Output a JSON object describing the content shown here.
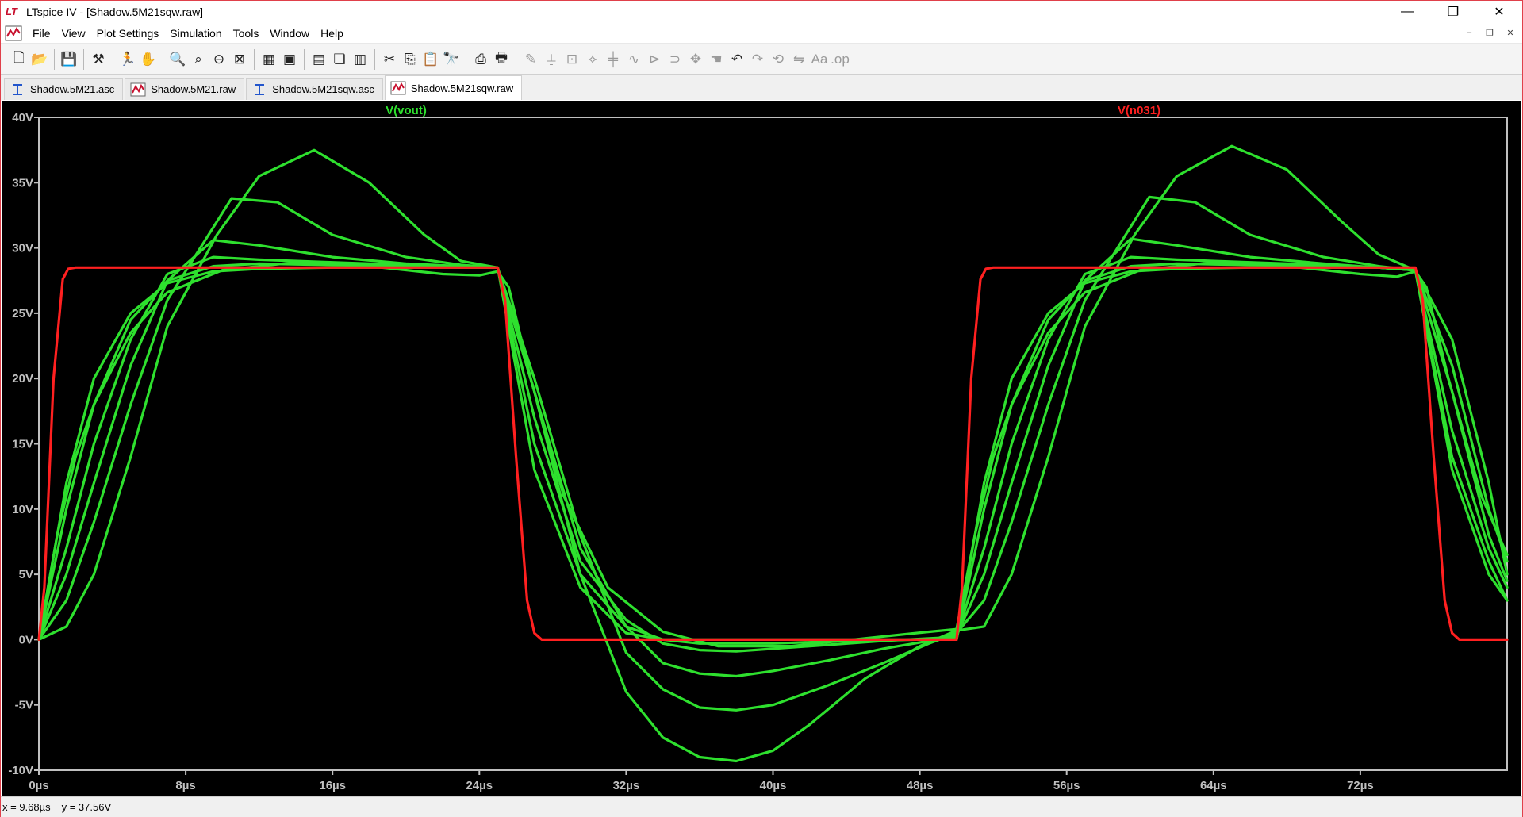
{
  "window": {
    "title": "LTspice IV - [Shadow.5M21sqw.raw]",
    "logo_text": "LT",
    "minimize": "—",
    "restore": "❐",
    "close": "✕"
  },
  "menu": {
    "items": [
      {
        "label": "File"
      },
      {
        "label": "View"
      },
      {
        "label": "Plot Settings"
      },
      {
        "label": "Simulation"
      },
      {
        "label": "Tools"
      },
      {
        "label": "Window"
      },
      {
        "label": "Help"
      }
    ],
    "mdi_minimize": "–",
    "mdi_restore": "❐",
    "mdi_close": "✕"
  },
  "toolbar": {
    "buttons": [
      {
        "icon": "new-schematic-icon",
        "glyph": "🗋",
        "enabled": true
      },
      {
        "icon": "open-icon",
        "glyph": "📂",
        "enabled": true
      },
      {
        "sep": true
      },
      {
        "icon": "save-icon",
        "glyph": "💾",
        "enabled": true
      },
      {
        "sep": true
      },
      {
        "icon": "control-panel-icon",
        "glyph": "⚒",
        "enabled": true
      },
      {
        "sep": true
      },
      {
        "icon": "run-icon",
        "glyph": "🏃",
        "enabled": true
      },
      {
        "icon": "halt-icon",
        "glyph": "✋",
        "enabled": false
      },
      {
        "sep": true
      },
      {
        "icon": "zoom-in-icon",
        "glyph": "🔍",
        "enabled": true
      },
      {
        "icon": "zoom-pan-icon",
        "glyph": "⌕",
        "enabled": true
      },
      {
        "icon": "zoom-out-icon",
        "glyph": "⊖",
        "enabled": true
      },
      {
        "icon": "zoom-fit-icon",
        "glyph": "⊠",
        "enabled": true
      },
      {
        "sep": true
      },
      {
        "icon": "autorange-icon",
        "glyph": "▦",
        "enabled": true
      },
      {
        "icon": "plot-settings-icon",
        "glyph": "▣",
        "enabled": true
      },
      {
        "sep": true
      },
      {
        "icon": "tile-horizontal-icon",
        "glyph": "▤",
        "enabled": true
      },
      {
        "icon": "cascade-icon",
        "glyph": "❏",
        "enabled": true
      },
      {
        "icon": "tile-vertical-icon",
        "glyph": "▥",
        "enabled": true
      },
      {
        "sep": true
      },
      {
        "icon": "cut-icon",
        "glyph": "✂",
        "enabled": true
      },
      {
        "icon": "copy-icon",
        "glyph": "⎘",
        "enabled": true
      },
      {
        "icon": "paste-icon",
        "glyph": "📋",
        "enabled": true
      },
      {
        "icon": "find-icon",
        "glyph": "🔭",
        "enabled": true
      },
      {
        "sep": true
      },
      {
        "icon": "print-preview-icon",
        "glyph": "⎙",
        "enabled": true
      },
      {
        "icon": "print-icon",
        "glyph": "🖶",
        "enabled": true
      },
      {
        "sep": true
      },
      {
        "icon": "wire-icon",
        "glyph": "✎",
        "enabled": false
      },
      {
        "icon": "ground-icon",
        "glyph": "⏚",
        "enabled": false
      },
      {
        "icon": "label-net-icon",
        "glyph": "⊡",
        "enabled": false
      },
      {
        "icon": "resistor-icon",
        "glyph": "⟡",
        "enabled": false
      },
      {
        "icon": "capacitor-icon",
        "glyph": "╪",
        "enabled": false
      },
      {
        "icon": "inductor-icon",
        "glyph": "∿",
        "enabled": false
      },
      {
        "icon": "diode-icon",
        "glyph": "⊳",
        "enabled": false
      },
      {
        "icon": "component-icon",
        "glyph": "⊃",
        "enabled": false
      },
      {
        "icon": "move-icon",
        "glyph": "✥",
        "enabled": false
      },
      {
        "icon": "drag-icon",
        "glyph": "☚",
        "enabled": false
      },
      {
        "icon": "undo-icon",
        "glyph": "↶",
        "enabled": true
      },
      {
        "icon": "redo-icon",
        "glyph": "↷",
        "enabled": false
      },
      {
        "icon": "rotate-icon",
        "glyph": "⟲",
        "enabled": false
      },
      {
        "icon": "mirror-icon",
        "glyph": "⇋",
        "enabled": false
      },
      {
        "icon": "text-icon",
        "glyph": "Aa",
        "enabled": false
      },
      {
        "icon": "spice-directive-icon",
        "glyph": ".op",
        "enabled": false
      }
    ]
  },
  "tabs": [
    {
      "label": "Shadow.5M21.asc",
      "icon": "schematic-icon",
      "active": false
    },
    {
      "label": "Shadow.5M21.raw",
      "icon": "waveform-icon",
      "active": false
    },
    {
      "label": "Shadow.5M21sqw.asc",
      "icon": "schematic-icon",
      "active": false
    },
    {
      "label": "Shadow.5M21sqw.raw",
      "icon": "waveform-icon",
      "active": true
    }
  ],
  "status": {
    "x": "x = 9.68µs",
    "y": "y = 37.56V"
  },
  "chart_data": {
    "type": "line",
    "xlabel": "",
    "ylabel": "",
    "xlim": [
      0,
      80
    ],
    "ylim": [
      -10,
      40
    ],
    "x_ticks": [
      0,
      8,
      16,
      24,
      32,
      40,
      48,
      56,
      64,
      72
    ],
    "x_tick_labels": [
      "0µs",
      "8µs",
      "16µs",
      "24µs",
      "32µs",
      "40µs",
      "48µs",
      "56µs",
      "64µs",
      "72µs"
    ],
    "y_ticks": [
      40,
      35,
      30,
      25,
      20,
      15,
      10,
      5,
      0,
      -5,
      -10
    ],
    "y_tick_labels": [
      "40V",
      "35V",
      "30V",
      "25V",
      "20V",
      "15V",
      "10V",
      "5V",
      "0V",
      "-5V",
      "-10V"
    ],
    "background": "#000000",
    "axis_color": "#c0c0c0",
    "series": [
      {
        "name": "V(n031)",
        "color": "#ff2020",
        "x": [
          0,
          0.3,
          0.8,
          1.3,
          1.6,
          2,
          25,
          25.4,
          26,
          26.6,
          27,
          27.4,
          50,
          50.3,
          50.8,
          51.3,
          51.6,
          52,
          75,
          75.4,
          76,
          76.6,
          77,
          77.4,
          80
        ],
        "y": [
          0,
          4,
          20,
          27.6,
          28.4,
          28.5,
          28.5,
          26,
          14,
          3,
          0.5,
          0,
          0,
          4,
          20,
          27.6,
          28.4,
          28.5,
          28.5,
          26,
          14,
          3,
          0.5,
          0,
          0
        ]
      },
      {
        "name": "V(vout)",
        "color": "#2ee02e",
        "x": [
          0,
          1.5,
          3,
          5,
          7,
          9.7,
          12,
          15,
          18,
          21,
          23,
          25,
          27,
          29.5,
          32,
          34,
          36,
          38,
          40,
          42,
          45,
          48,
          50,
          51.5,
          53,
          55,
          57,
          59.7,
          62,
          65,
          68,
          71,
          73,
          75,
          77,
          79,
          80
        ],
        "y": [
          0,
          1,
          5,
          14,
          24,
          31,
          35.5,
          37.5,
          35,
          31,
          29,
          28.5,
          19,
          5,
          -4,
          -7.5,
          -9,
          -9.3,
          -8.5,
          -6.5,
          -3,
          -0.5,
          0.7,
          1,
          5,
          14,
          24,
          31,
          35.5,
          37.8,
          36,
          32,
          29.5,
          28.3,
          23,
          12,
          5
        ]
      },
      {
        "name": "",
        "color": "#2ee02e",
        "x": [
          0,
          1.5,
          3,
          5,
          7,
          10.5,
          13,
          16,
          20,
          23,
          25,
          27,
          29.5,
          32,
          34,
          36,
          38,
          40,
          43,
          46,
          48.5,
          50,
          51.5,
          53,
          55,
          57,
          60.5,
          63,
          66,
          70,
          73,
          75,
          77,
          79,
          80
        ],
        "y": [
          0,
          3,
          9,
          18,
          26,
          33.8,
          33.5,
          31,
          29.3,
          28.7,
          28.5,
          20,
          8,
          -1,
          -3.8,
          -5.2,
          -5.4,
          -5,
          -3.5,
          -1.8,
          -0.3,
          0.5,
          3,
          9,
          18,
          26,
          33.9,
          33.5,
          31,
          29.3,
          28.6,
          28.3,
          21,
          10,
          6
        ]
      },
      {
        "name": "",
        "color": "#2ee02e",
        "x": [
          0,
          1.5,
          3,
          5,
          7,
          9.5,
          12,
          16,
          20,
          23,
          25,
          27,
          29.5,
          32,
          34,
          36,
          38,
          40,
          43,
          46,
          48.5,
          50,
          51.5,
          53,
          55,
          57,
          59.5,
          62,
          66,
          70,
          73,
          75,
          77,
          79,
          80
        ],
        "y": [
          0,
          5,
          12,
          21,
          27.5,
          30.6,
          30.2,
          29.3,
          28.8,
          28.6,
          28.5,
          19,
          7,
          1,
          -1.8,
          -2.6,
          -2.8,
          -2.4,
          -1.6,
          -0.7,
          -0.1,
          0.3,
          5,
          12,
          21,
          27.5,
          30.7,
          30.2,
          29.3,
          28.8,
          28.5,
          28.3,
          19,
          8,
          4.5
        ]
      },
      {
        "name": "",
        "color": "#2ee02e",
        "x": [
          0,
          1.5,
          3,
          5,
          7,
          9.5,
          12,
          16,
          20,
          23,
          25,
          27,
          29.5,
          32,
          34,
          36,
          38,
          40,
          43,
          46,
          48.5,
          50,
          51.5,
          53,
          55,
          57,
          59.5,
          62,
          66,
          70,
          73,
          75,
          77,
          79,
          80
        ],
        "y": [
          0,
          7,
          15,
          23,
          28,
          29.3,
          29.1,
          28.9,
          28.7,
          28.6,
          28.5,
          17,
          6,
          1.5,
          -0.3,
          -0.8,
          -0.9,
          -0.7,
          -0.4,
          -0.1,
          0.1,
          0.2,
          7,
          15,
          23,
          28,
          29.3,
          29.1,
          28.9,
          28.7,
          28.5,
          28.3,
          16,
          7,
          4
        ]
      },
      {
        "name": "",
        "color": "#2ee02e",
        "x": [
          0,
          1.5,
          3,
          5,
          7,
          9.5,
          12,
          16,
          20,
          23,
          25,
          27,
          29.5,
          32,
          34,
          36,
          40,
          44,
          48,
          50,
          51.5,
          53,
          55,
          57,
          59.5,
          62,
          66,
          70,
          73,
          75,
          77,
          79,
          80
        ],
        "y": [
          0,
          10,
          18,
          24.5,
          27.5,
          28.6,
          28.8,
          28.7,
          28.6,
          28.5,
          28.5,
          15,
          5,
          1,
          0,
          -0.3,
          -0.3,
          -0.1,
          0,
          0,
          10,
          18,
          24.5,
          27.5,
          28.6,
          28.8,
          28.7,
          28.6,
          28.5,
          28.3,
          14,
          6,
          3
        ]
      },
      {
        "name": "",
        "color": "#2ee02e",
        "x": [
          0,
          1.5,
          3,
          5,
          7,
          9.5,
          12,
          16,
          20,
          23,
          25,
          27,
          29.5,
          32,
          34,
          36,
          40,
          44,
          48,
          50,
          51.5,
          53,
          55,
          57,
          59.5,
          62,
          66,
          70,
          73,
          75,
          77,
          79,
          80
        ],
        "y": [
          0,
          12,
          20,
          25,
          27.3,
          28.2,
          28.4,
          28.5,
          28.5,
          28.5,
          28.5,
          13,
          4,
          0.5,
          0,
          0,
          0,
          0,
          0,
          0,
          12,
          20,
          25,
          27.3,
          28.2,
          28.4,
          28.5,
          28.5,
          28.5,
          28.3,
          13,
          5,
          3
        ]
      },
      {
        "name": "",
        "color": "#2ee02e",
        "x": [
          0,
          1,
          2,
          3,
          5,
          7,
          10,
          14,
          18,
          22,
          24,
          25,
          25.6,
          26.8,
          28.6,
          31,
          34,
          37,
          41,
          45,
          48.5,
          50,
          51,
          52,
          53,
          55,
          57,
          60,
          64,
          68,
          72,
          74,
          75,
          75.6,
          76.8,
          78.6,
          80
        ],
        "y": [
          0,
          8,
          14,
          18,
          23.5,
          26.6,
          28.3,
          28.9,
          28.6,
          28,
          27.9,
          28.2,
          27,
          20,
          11,
          4,
          0.6,
          -0.5,
          -0.5,
          0.1,
          0.6,
          0.8,
          8,
          14,
          18,
          23.5,
          26.6,
          28.3,
          28.9,
          28.6,
          28,
          27.8,
          28.2,
          27,
          20,
          11,
          6.5
        ]
      }
    ]
  }
}
